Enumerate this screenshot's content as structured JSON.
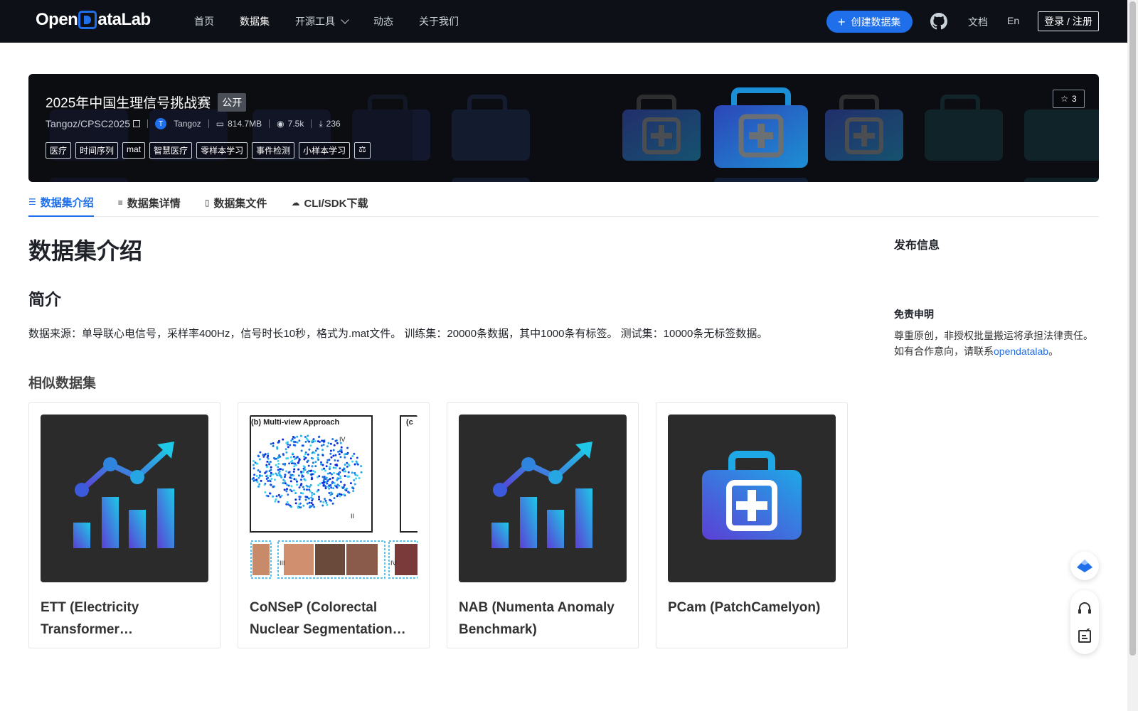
{
  "nav": {
    "logo": "OpenDataLab",
    "items": [
      {
        "label": "首页"
      },
      {
        "label": "数据集"
      },
      {
        "label": "开源工具"
      },
      {
        "label": "动态"
      },
      {
        "label": "关于我们"
      }
    ],
    "create_button": "创建数据集",
    "docs": "文档",
    "lang": "En",
    "login": "登录 / 注册"
  },
  "dataset": {
    "title": "2025年中国生理信号挑战赛",
    "visibility": "公开",
    "repo": "Tangoz/CPSC2025",
    "owner_initial": "T",
    "owner": "Tangoz",
    "size": "814.7MB",
    "views": "7.5k",
    "downloads": "236",
    "stars": "3",
    "tags": [
      "医疗",
      "时间序列",
      "mat",
      "智慧医疗",
      "零样本学习",
      "事件检测",
      "小样本学习"
    ]
  },
  "tabs": [
    {
      "label": "数据集介绍",
      "icon": "database-icon"
    },
    {
      "label": "数据集详情",
      "icon": "list-icon"
    },
    {
      "label": "数据集文件",
      "icon": "file-icon"
    },
    {
      "label": "CLI/SDK下载",
      "icon": "cloud-download-icon"
    }
  ],
  "content": {
    "heading": "数据集介绍",
    "subheading": "简介",
    "description": "数据来源：单导联心电信号，采样率400Hz，信号时长10秒，格式为.mat文件。 训练集：20000条数据，其中1000条有标签。 测试集：10000条无标签数据。",
    "similar_heading": "相似数据集"
  },
  "similar": [
    {
      "title": "ETT (Electricity Transformer Temperature)",
      "thumb": "chart-icon"
    },
    {
      "title": "CoNSeP (Colorectal Nuclear Segmentation and Phenotypes)",
      "thumb": "scatter-figure"
    },
    {
      "title": "NAB (Numenta Anomaly Benchmark)",
      "thumb": "chart-icon"
    },
    {
      "title": "PCam (PatchCamelyon)",
      "thumb": "medical-kit-icon"
    }
  ],
  "side": {
    "publish_heading": "发布信息",
    "disclaimer_heading": "免责申明",
    "disclaimer_line1": "尊重原创，非授权批量搬运将承担法律责任。",
    "disclaimer_line2_pre": "如有合作意向，请联系",
    "disclaimer_link": "opendatalab",
    "disclaimer_line2_post": "。"
  },
  "colors": {
    "accent": "#1f6feb",
    "topbar": "#0d1117"
  }
}
